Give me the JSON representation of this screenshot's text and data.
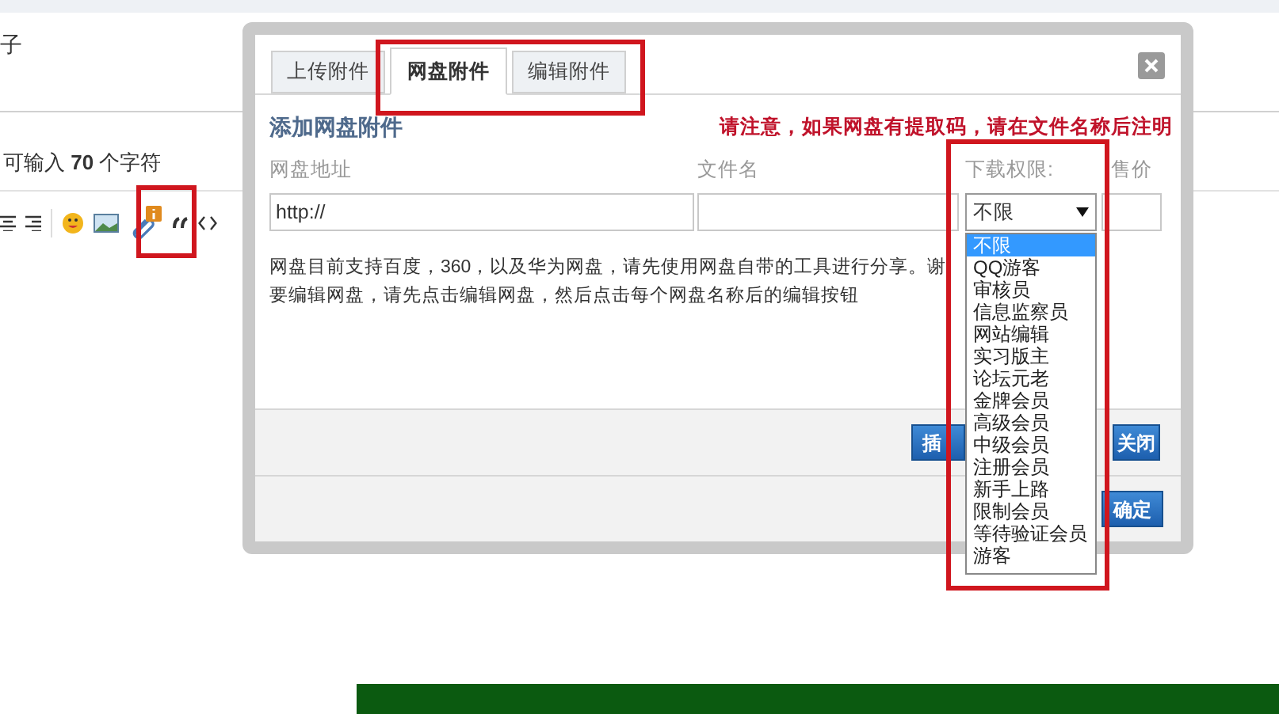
{
  "page": {
    "title_fragment": "子",
    "char_limit": "可输入 **70** 个字符"
  },
  "dialog": {
    "tabs": [
      {
        "label": "上传附件",
        "selected": false
      },
      {
        "label": "网盘附件",
        "selected": true
      },
      {
        "label": "编辑附件",
        "selected": false
      }
    ],
    "title": "添加网盘附件",
    "notice": "请注意，如果网盘有提取码，请在文件名称后注明",
    "fields": [
      {
        "label": "网盘地址",
        "kind": "text",
        "value": "http://"
      },
      {
        "label": "文件名",
        "kind": "text"
      },
      {
        "label": "下载权限:",
        "kind": "select",
        "value": "不限"
      },
      {
        "label": "售价",
        "kind": "text"
      }
    ],
    "description": [
      "网盘目前支持百度，360，以及华为网盘，请先使用网盘自带的工具进行分享。谢",
      "要编辑网盘，请先点击编辑网盘，然后点击每个网盘名称后的编辑按钮"
    ],
    "footer_upper_buttons": [
      {
        "label": "插"
      },
      {
        "label": "关闭"
      }
    ],
    "footer_lower_buttons": [
      {
        "label": "确定"
      }
    ],
    "dropdown": [
      {
        "label": "不限",
        "selected": true
      },
      {
        "label": "QQ游客",
        "selected": false
      },
      {
        "label": "审核员",
        "selected": false
      },
      {
        "label": "信息监察员",
        "selected": false
      },
      {
        "label": "网站编辑",
        "selected": false
      },
      {
        "label": "实习版主",
        "selected": false
      },
      {
        "label": "论坛元老",
        "selected": false
      },
      {
        "label": "金牌会员",
        "selected": false
      },
      {
        "label": "高级会员",
        "selected": false
      },
      {
        "label": "中级会员",
        "selected": false
      },
      {
        "label": "注册会员",
        "selected": false
      },
      {
        "label": "新手上路",
        "selected": false
      },
      {
        "label": "限制会员",
        "selected": false
      },
      {
        "label": "等待验证会员",
        "selected": false
      },
      {
        "label": "游客",
        "selected": false
      }
    ]
  }
}
